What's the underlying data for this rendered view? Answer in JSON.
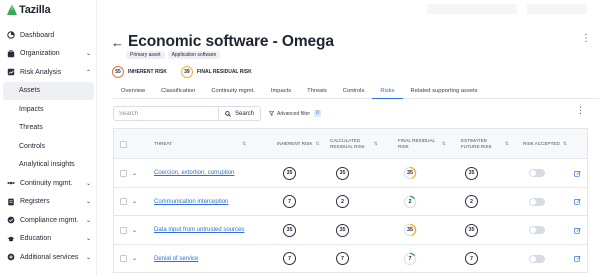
{
  "app": {
    "name": "Tazilla",
    "accent": "#2f6fd6",
    "logo_green": "#3aa756"
  },
  "sidebar": {
    "items": [
      {
        "label": "Dashboard",
        "icon": "dashboard-icon"
      },
      {
        "label": "Organization",
        "icon": "organization-icon",
        "chevron": "⌄"
      },
      {
        "label": "Risk Analysis",
        "icon": "risk-analysis-icon",
        "chevron": "⌃"
      },
      {
        "label": "Assets",
        "sub": true,
        "active": true
      },
      {
        "label": "Impacts",
        "sub": true
      },
      {
        "label": "Threats",
        "sub": true
      },
      {
        "label": "Controls",
        "sub": true
      },
      {
        "label": "Analytical insights",
        "sub": true
      },
      {
        "label": "Continuity mgmt.",
        "icon": "continuity-icon",
        "chevron": "⌄"
      },
      {
        "label": "Registers",
        "icon": "registers-icon",
        "chevron": "⌄"
      },
      {
        "label": "Compliance mgmt.",
        "icon": "compliance-icon",
        "chevron": "⌄"
      },
      {
        "label": "Education",
        "icon": "education-icon",
        "chevron": "⌄"
      },
      {
        "label": "Additional services",
        "icon": "additional-services-icon",
        "chevron": "⌄"
      }
    ]
  },
  "header": {
    "back": "←",
    "title": "Economic software - Omega",
    "tags": [
      "Primary asset",
      "Application software"
    ]
  },
  "risk_summary": {
    "inherent": {
      "value": "55",
      "label": "INHERENT RISK",
      "color": "#e8733a"
    },
    "final": {
      "value": "39",
      "label": "FINAL RESIDUAL RISK",
      "color": "#f0b429"
    }
  },
  "tabs": [
    {
      "label": "Overview"
    },
    {
      "label": "Classification"
    },
    {
      "label": "Continuity mgmt."
    },
    {
      "label": "Impacts"
    },
    {
      "label": "Threats"
    },
    {
      "label": "Controls"
    },
    {
      "label": "Risks",
      "active": true
    },
    {
      "label": "Related supporting assets"
    }
  ],
  "toolbar": {
    "search_placeholder": "Search",
    "search_label": "Search",
    "filter_label": "Advanced filter",
    "filter_count": "0"
  },
  "table": {
    "columns": [
      {
        "key": "threat",
        "label": "THREAT"
      },
      {
        "key": "inherent",
        "label": "INHERENT RISK"
      },
      {
        "key": "calc",
        "label": "CALCULATED RESIDUAL RISK"
      },
      {
        "key": "final",
        "label": "FINAL RESIDUAL RISK"
      },
      {
        "key": "future",
        "label": "ESTIMATED FUTURE RISK"
      },
      {
        "key": "accepted",
        "label": "RISK ACCEPTED"
      }
    ],
    "rows": [
      {
        "threat": "Coercion, extortion, corruption",
        "inherent": "35",
        "calc": "35",
        "final": "35",
        "final_color": "#f0b429",
        "final_fill": 0.45,
        "future": "35",
        "accepted": false
      },
      {
        "threat": "Communication interception",
        "inherent": "7",
        "calc": "2",
        "final": "2",
        "final_color": "#3aa756",
        "final_fill": 0.15,
        "future": "2",
        "accepted": false
      },
      {
        "threat": "Data input from untrusted sources",
        "inherent": "35",
        "calc": "35",
        "final": "35",
        "final_color": "#f0b429",
        "final_fill": 0.45,
        "future": "35",
        "accepted": false
      },
      {
        "threat": "Denial of service",
        "inherent": "7",
        "calc": "7",
        "final": "7",
        "final_color": "#3aa756",
        "final_fill": 0.15,
        "future": "7",
        "accepted": false
      }
    ]
  }
}
